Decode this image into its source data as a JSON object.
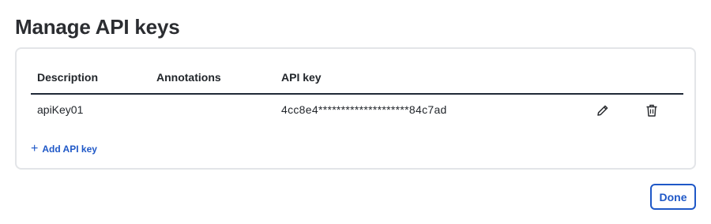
{
  "title": "Manage API keys",
  "table": {
    "columns": [
      "Description",
      "Annotations",
      "API key"
    ],
    "rows": [
      {
        "description": "apiKey01",
        "annotations": "",
        "api_key": "4cc8e4********************84c7ad"
      }
    ]
  },
  "actions": {
    "add_label": "Add API key",
    "done_label": "Done"
  },
  "icons": {
    "edit": "pencil-icon",
    "delete": "trash-icon",
    "add": "plus-icon"
  },
  "colors": {
    "accent": "#1f58c7",
    "text": "#22262b",
    "border": "#e3e5e8"
  }
}
